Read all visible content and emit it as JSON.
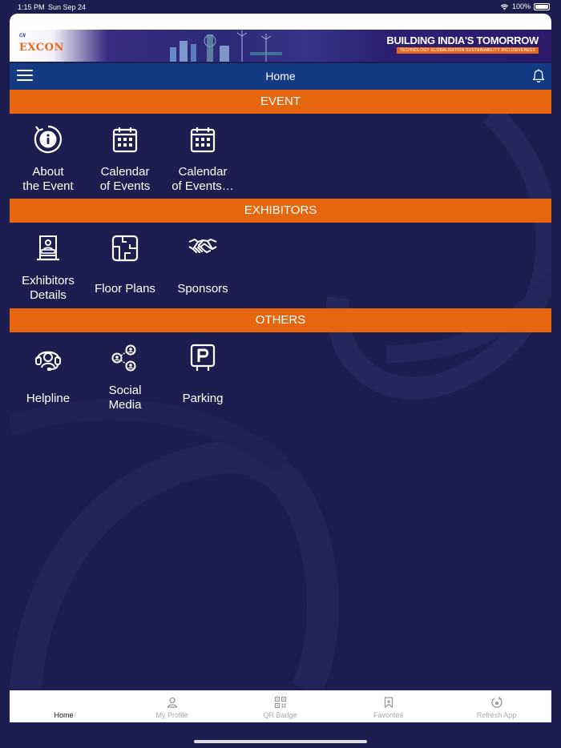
{
  "status": {
    "time": "1:15 PM",
    "date": "Sun Sep 24",
    "battery": "100%"
  },
  "banner": {
    "org": "CII",
    "logo": "EXCON",
    "headline": "BUILDING INDIA'S TOMORROW",
    "tagline": "TECHNOLOGY  GLOBALISATION  SUSTAINABILITY  INCLUSIVENESS"
  },
  "navbar": {
    "title": "Home",
    "menu_icon": "hamburger-icon",
    "bell_icon": "bell-icon"
  },
  "sections": [
    {
      "title": "EVENT",
      "tiles": [
        {
          "label": "About\nthe Event",
          "icon": "info-icon"
        },
        {
          "label": "Calendar\nof Events",
          "icon": "calendar-icon"
        },
        {
          "label": "Calendar\nof Events…",
          "icon": "calendar-icon"
        }
      ]
    },
    {
      "title": "EXHIBITORS",
      "tiles": [
        {
          "label": "Exhibitors\nDetails",
          "icon": "exhibitor-booth-icon"
        },
        {
          "label": "Floor Plans",
          "icon": "floor-plan-icon"
        },
        {
          "label": "Sponsors",
          "icon": "handshake-icon"
        }
      ]
    },
    {
      "title": "OTHERS",
      "tiles": [
        {
          "label": "Helpline",
          "icon": "headset-icon"
        },
        {
          "label": "Social\nMedia",
          "icon": "social-network-icon"
        },
        {
          "label": "Parking",
          "icon": "parking-icon"
        }
      ]
    }
  ],
  "tabs": [
    {
      "label": "Home",
      "icon": "home-icon",
      "active": true
    },
    {
      "label": "My Profile",
      "icon": "user-icon",
      "active": false
    },
    {
      "label": "QR Badge",
      "icon": "qr-code-icon",
      "active": false
    },
    {
      "label": "Favorites",
      "icon": "bookmark-icon",
      "active": false
    },
    {
      "label": "Refresh App",
      "icon": "refresh-icon",
      "active": false
    }
  ],
  "colors": {
    "background": "#1d1e4f",
    "navbar": "#143a84",
    "section": "#e6650f",
    "tabbar": "#ffffff"
  }
}
